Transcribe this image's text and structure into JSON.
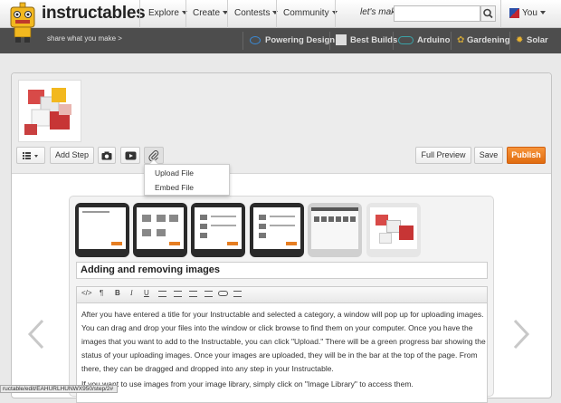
{
  "site": {
    "name": "instructables",
    "tagline": "share what you make >"
  },
  "nav": {
    "items": [
      {
        "label": "Explore"
      },
      {
        "label": "Create"
      },
      {
        "label": "Contests"
      },
      {
        "label": "Community"
      }
    ],
    "lets_make": "let's make",
    "search_value": "",
    "user_label": "You"
  },
  "channels": [
    {
      "label": "Powering Design",
      "icon": "powering-design-icon"
    },
    {
      "label": "Best Builds",
      "icon": "best-builds-icon"
    },
    {
      "label": "Arduino",
      "icon": "arduino-icon"
    },
    {
      "label": "Gardening",
      "icon": "gardening-icon"
    },
    {
      "label": "Solar",
      "icon": "solar-icon"
    }
  ],
  "toolbar": {
    "add_step": "Add Step",
    "full_preview": "Full Preview",
    "save": "Save",
    "publish": "Publish",
    "accent": "#f0841f"
  },
  "attach_menu": [
    "Upload File",
    "Embed File"
  ],
  "step": {
    "title": "Adding and removing images",
    "paragraphs": [
      "After you have entered a title for your Instructable and selected a category, a window will pop up for uploading images. You can drag and drop your files into the window or click browse to find them on your computer. Once you have the images that you want to add to the Instructable, you can click \"Upload.\" There will be a green progress bar showing the status of your uploading images. Once your images are uploaded, they will be in the bar at the top of the page. From there, they can be dragged and dropped into any step in your Instructable.",
      "If you want to use images from your image library, simply click on \"Image Library\" to access them."
    ]
  },
  "formatting": [
    "</>",
    "¶",
    "B",
    "I",
    "U",
    "list-bullet",
    "list-number",
    "outdent",
    "indent",
    "link",
    "align"
  ],
  "status_bar": "ructable/edit/EAHURLHUNWX950/step/2#"
}
